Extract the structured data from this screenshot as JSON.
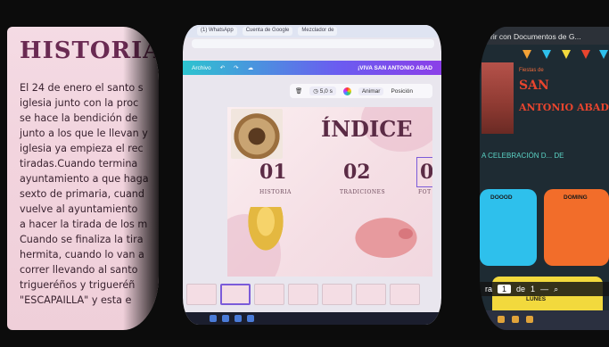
{
  "left_document": {
    "title": "HISTORIA",
    "lines": [
      "El 24 de enero el santo s",
      "iglesia junto con la proc",
      "se hace la bendición de",
      "junto a los que le llevan y",
      "iglesia ya empieza el rec",
      "tiradas.Cuando termina",
      "ayuntamiento a que haga",
      "sexto de primaria, cuand",
      "vuelve al ayuntamiento",
      "a hacer la tirada de los m",
      "Cuando se finaliza la tira",
      "hermita, cuando lo van a",
      "correr llevando al santo",
      "trigueréños y trigueréñ",
      "\"ESCAPAILLA\" y esta e"
    ]
  },
  "center_editor": {
    "browser_tabs": [
      "(1) WhatsApp",
      "Cuenta de Google",
      "Mezclador de"
    ],
    "editor_bar": {
      "menu_label": "Archivo",
      "title": "¡VIVA SAN ANTONIO ABAD"
    },
    "toolbar": {
      "duration": "5,0 s",
      "animate_label": "Animar",
      "position_label": "Posición"
    },
    "slide": {
      "title": "ÍNDICE",
      "items": [
        {
          "number": "01",
          "label": "HISTORIA"
        },
        {
          "number": "02",
          "label": "TRADICIONES"
        },
        {
          "number": "0",
          "label": "FOT"
        }
      ]
    },
    "thumbnail_count": 7
  },
  "right_presentation": {
    "tab_title": "rir con Documentos de G...",
    "header_small": "Fiestas de",
    "header_san": "SAN",
    "header_antonio": "ANTONIO ABAD",
    "subtitle": "A CELEBRACIÓN D... DE",
    "cards": [
      {
        "title": "DOOOD",
        "color": "#2ec0ec"
      },
      {
        "title": "DOMING",
        "color": "#f26d2a"
      }
    ],
    "yellow_card_title": "LUNES",
    "pager": {
      "prefix": "ra",
      "current": "1",
      "of_label": "de",
      "total": "1"
    },
    "colors": {
      "background": "#1e2b33",
      "accent_red": "#e8452e"
    }
  }
}
